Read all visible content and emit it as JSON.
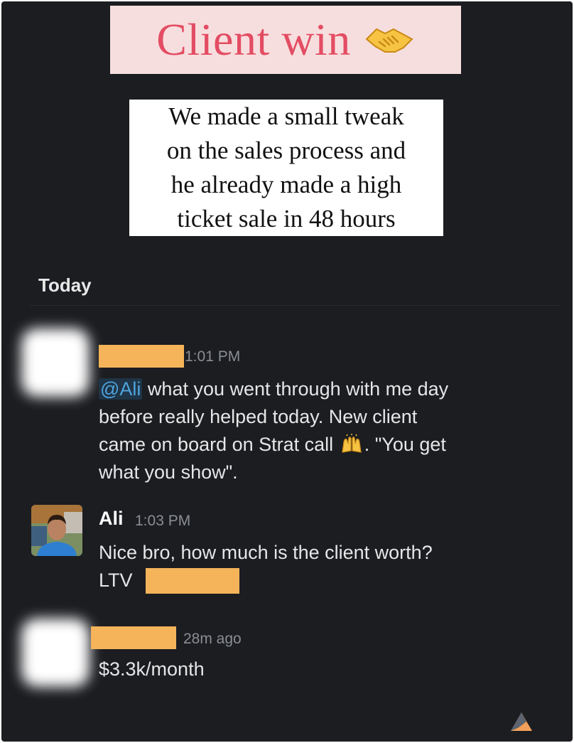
{
  "banner": {
    "title": "Client win",
    "icon": "handshake-icon"
  },
  "caption": {
    "lines": [
      "We made a small tweak",
      "on the sales process and",
      "he already made a high",
      "ticket sale in 48 hours"
    ]
  },
  "chat": {
    "day_label": "Today",
    "messages": [
      {
        "time": "1:01 PM",
        "mention": "@Ali",
        "lines": [
          " what you went through with me day",
          "before really helped today. New client",
          "came on board on Strat call",
          ". \"You get",
          "what you show\"."
        ]
      },
      {
        "name": "Ali",
        "time": "1:03 PM",
        "lines": [
          "Nice bro, how much is the client worth?",
          "LTV"
        ]
      },
      {
        "time": "28m ago",
        "lines": [
          "$3.3k/month"
        ]
      }
    ]
  },
  "colors": {
    "background": "#1b1d21",
    "title": "#e34d63",
    "banner": "#f7dede",
    "redaction": "#f5b45a",
    "mention": "#4ea4de"
  }
}
